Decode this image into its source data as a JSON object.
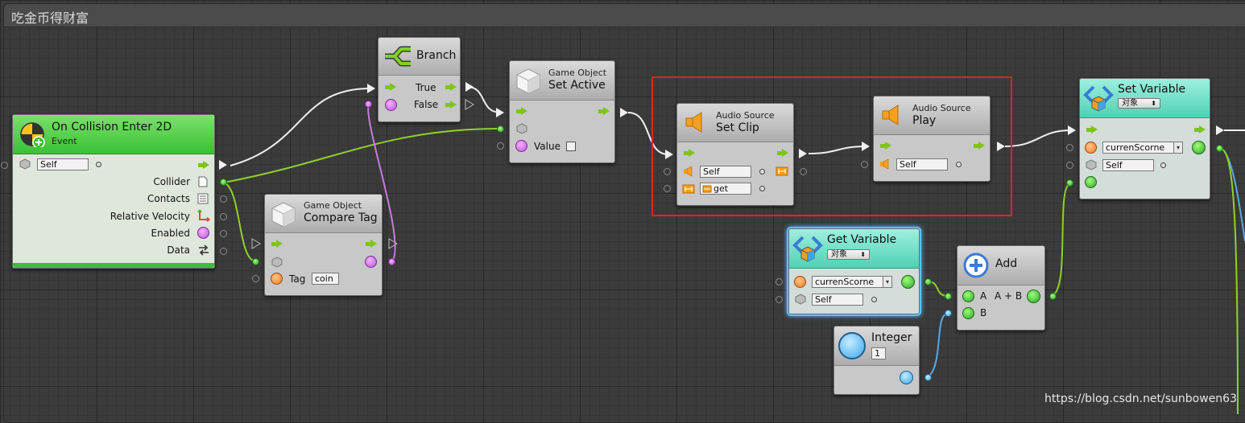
{
  "canvas": {
    "title": "吃金币得财富"
  },
  "nodes": {
    "on_collision": {
      "title": "On Collision Enter 2D",
      "subtitle": "Event",
      "target_value": "Self",
      "outputs": [
        "Collider",
        "Contacts",
        "Relative Velocity",
        "Enabled",
        "Data"
      ]
    },
    "branch": {
      "title": "Branch",
      "true_label": "True",
      "false_label": "False"
    },
    "set_active": {
      "category": "Game Object",
      "title": "Set Active",
      "value_label": "Value"
    },
    "compare_tag": {
      "category": "Game Object",
      "title": "Compare Tag",
      "tag_label": "Tag",
      "tag_value": "coin"
    },
    "set_clip": {
      "category": "Audio Source",
      "title": "Set Clip",
      "target_value": "Self",
      "clip_value": "get"
    },
    "play": {
      "category": "Audio Source",
      "title": "Play",
      "target_value": "Self"
    },
    "set_variable": {
      "title": "Set Variable",
      "scope": "对象",
      "var_name": "currenScorne",
      "target_value": "Self"
    },
    "get_variable": {
      "title": "Get Variable",
      "scope": "对象",
      "var_name": "currenScorne",
      "target_value": "Self"
    },
    "add": {
      "title": "Add",
      "a_label": "A",
      "result_label": "A + B",
      "b_label": "B"
    },
    "integer": {
      "title": "Integer",
      "value": "1"
    }
  },
  "watermark": "https://blog.csdn.net/sunbowen63",
  "colors": {
    "flow": "#7ec41a",
    "wire_white": "#eeeeee",
    "wire_green": "#8fd12a",
    "wire_purple": "#c87be0",
    "wire_blue": "#5aa7e6",
    "highlight": "#e02323"
  }
}
